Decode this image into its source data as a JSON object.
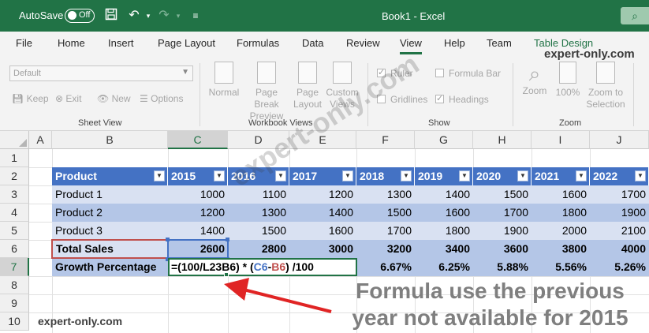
{
  "titlebar": {
    "autosave_label": "AutoSave",
    "autosave_state": "Off",
    "window_title": "Book1  -  Excel",
    "bg_color": "#217346"
  },
  "ribbon_tabs": [
    "File",
    "Home",
    "Insert",
    "Page Layout",
    "Formulas",
    "Data",
    "Review",
    "View",
    "Help",
    "Team",
    "Table Design"
  ],
  "active_tab": "View",
  "brand_top": "expert-only.com",
  "sheet_view": {
    "dropdown_value": "Default",
    "buttons": [
      "Keep",
      "Exit",
      "New",
      "Options"
    ],
    "group_label": "Sheet View"
  },
  "workbook_views": {
    "buttons": [
      {
        "line1": "Normal",
        "line2": ""
      },
      {
        "line1": "Page Break",
        "line2": "Preview"
      },
      {
        "line1": "Page",
        "line2": "Layout"
      },
      {
        "line1": "Custom",
        "line2": "Views"
      }
    ],
    "group_label": "Workbook Views"
  },
  "show": {
    "checkboxes": [
      {
        "label": "Ruler",
        "checked": true
      },
      {
        "label": "Formula Bar",
        "checked": false
      },
      {
        "label": "Gridlines",
        "checked": false
      },
      {
        "label": "Headings",
        "checked": true
      }
    ],
    "group_label": "Show"
  },
  "zoom": {
    "buttons": [
      {
        "line1": "Zoom",
        "line2": ""
      },
      {
        "line1": "100%",
        "line2": ""
      },
      {
        "line1": "Zoom to",
        "line2": "Selection"
      }
    ],
    "group_label": "Zoom"
  },
  "grid": {
    "columns": [
      "A",
      "B",
      "C",
      "D",
      "E",
      "F",
      "G",
      "H",
      "I",
      "J"
    ],
    "rows": [
      "1",
      "2",
      "3",
      "4",
      "5",
      "6",
      "7",
      "8",
      "9",
      "10"
    ],
    "selected_column": "C",
    "selected_row": "7"
  },
  "table": {
    "headers": [
      "Product",
      "2015",
      "2016",
      "2017",
      "2018",
      "2019",
      "2020",
      "2021",
      "2022"
    ],
    "rows": [
      {
        "label": "Product 1",
        "values": [
          "1000",
          "1100",
          "1200",
          "1300",
          "1400",
          "1500",
          "1600",
          "1700"
        ]
      },
      {
        "label": "Product 2",
        "values": [
          "1200",
          "1300",
          "1400",
          "1500",
          "1600",
          "1700",
          "1800",
          "1900"
        ]
      },
      {
        "label": "Product 3",
        "values": [
          "1400",
          "1500",
          "1600",
          "1700",
          "1800",
          "1900",
          "2000",
          "2100"
        ]
      },
      {
        "label": "Total Sales",
        "values": [
          "2600",
          "2800",
          "3000",
          "3200",
          "3400",
          "3600",
          "3800",
          "4000"
        ]
      }
    ],
    "growth_label": "Growth Percentage",
    "growth_values": [
      "6.67%",
      "6.25%",
      "5.88%",
      "5.56%",
      "5.26%"
    ],
    "formula": {
      "part1": "=(100/L23B6) * (",
      "ref_c6": "C6",
      "minus": "-",
      "ref_b6": "B6",
      "part2": ") /100"
    },
    "header_color": "#4472c4",
    "band_dark": "#b4c6e7",
    "band_light": "#d9e1f2"
  },
  "watermark": "expert-only.com",
  "brand_bottom": "expert-only.com",
  "callout": {
    "line1": "Formula use the previous",
    "line2": "year not available for 2015"
  }
}
